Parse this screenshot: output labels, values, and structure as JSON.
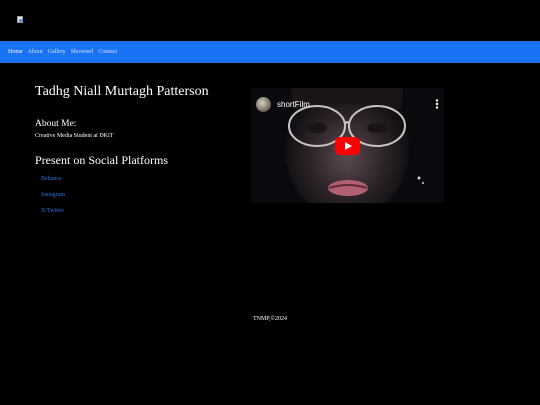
{
  "header": {
    "logo_icon": "broken-image-icon"
  },
  "nav": {
    "items": [
      {
        "label": "Home"
      },
      {
        "label": "About"
      },
      {
        "label": "Gallery"
      },
      {
        "label": "Showreel"
      },
      {
        "label": "Contact"
      }
    ],
    "active": "Home",
    "background_color": "#1a73f5"
  },
  "profile": {
    "name": "Tadhg Niall Murtagh Patterson",
    "about_heading": "About Me:",
    "about_text": "Creative Media Student at DKiT"
  },
  "social": {
    "heading": "Present on Social Platforms",
    "links": [
      {
        "label": "Behance"
      },
      {
        "label": "Instagram"
      },
      {
        "label": "X/Twitter"
      }
    ],
    "link_color": "#2f6fe0"
  },
  "video": {
    "title": "shortFilm",
    "play_icon": "youtube-play-icon",
    "menu_icon": "more-vertical-icon"
  },
  "footer": {
    "text": "TNMP,©2024"
  }
}
